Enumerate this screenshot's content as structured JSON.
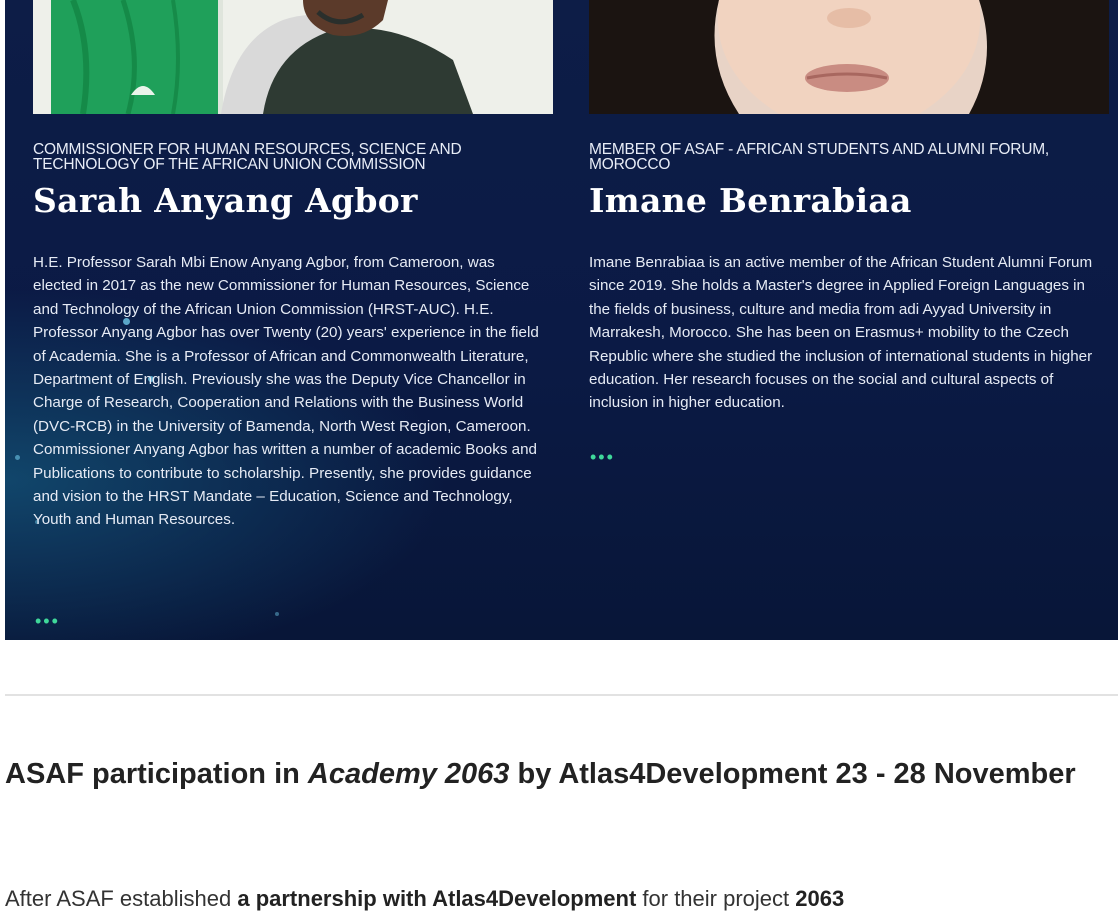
{
  "speakers": [
    {
      "role": "COMMISSIONER FOR HUMAN RESOURCES, SCIENCE AND TECHNOLOGY OF THE AFRICAN UNION COMMISSION",
      "name": "Sarah Anyang Agbor",
      "bio": "H.E. Professor Sarah Mbi Enow Anyang Agbor, from Cameroon, was elected in 2017 as the new Commissioner for Human Resources, Science and Technology of the African Union Commission (HRST-AUC). H.E. Professor Anyang Agbor has over Twenty (20) years' experience in the field of Academia. She is a Professor of African and Commonwealth Literature, Department of English. Previously she was the Deputy Vice Chancellor in Charge of Research, Cooperation and Relations with the Business World (DVC-RCB) in the University of Bamenda, North West Region, Cameroon. Commissioner Anyang Agbor has written a number of academic Books and Publications to contribute to scholarship. Presently, she provides guidance and vision to the HRST Mandate – Education, Science and Technology, Youth and Human Resources.",
      "more": "•••"
    },
    {
      "role": "MEMBER OF ASAF - AFRICAN STUDENTS AND ALUMNI FORUM, MOROCCO",
      "name": "Imane Benrabiaa",
      "bio": "Imane Benrabiaa is an active member of the African Student Alumni Forum since 2019. She holds a Master's degree in Applied Foreign Languages in the fields of business, culture and media from adi Ayyad University in Marrakesh, Morocco. She has been on Erasmus+ mobility to the Czech Republic where she studied the inclusion of international students in higher education. Her research focuses on the social and cultural aspects of inclusion in higher education.",
      "more": "•••"
    }
  ],
  "article": {
    "heading_part1": "ASAF participation in ",
    "heading_italic": "Academy 2063",
    "heading_part2": " by Atlas4Development 23 - 28 November",
    "para_part1": "After ASAF established ",
    "para_bold1": "a partnership with Atlas4Development",
    "para_part2": " for their project ",
    "para_bold2": "2063"
  },
  "colors": {
    "banner_bg": "#0d1d47",
    "accent_dots": "#3fd89a",
    "flag_green": "#1fa05a"
  }
}
